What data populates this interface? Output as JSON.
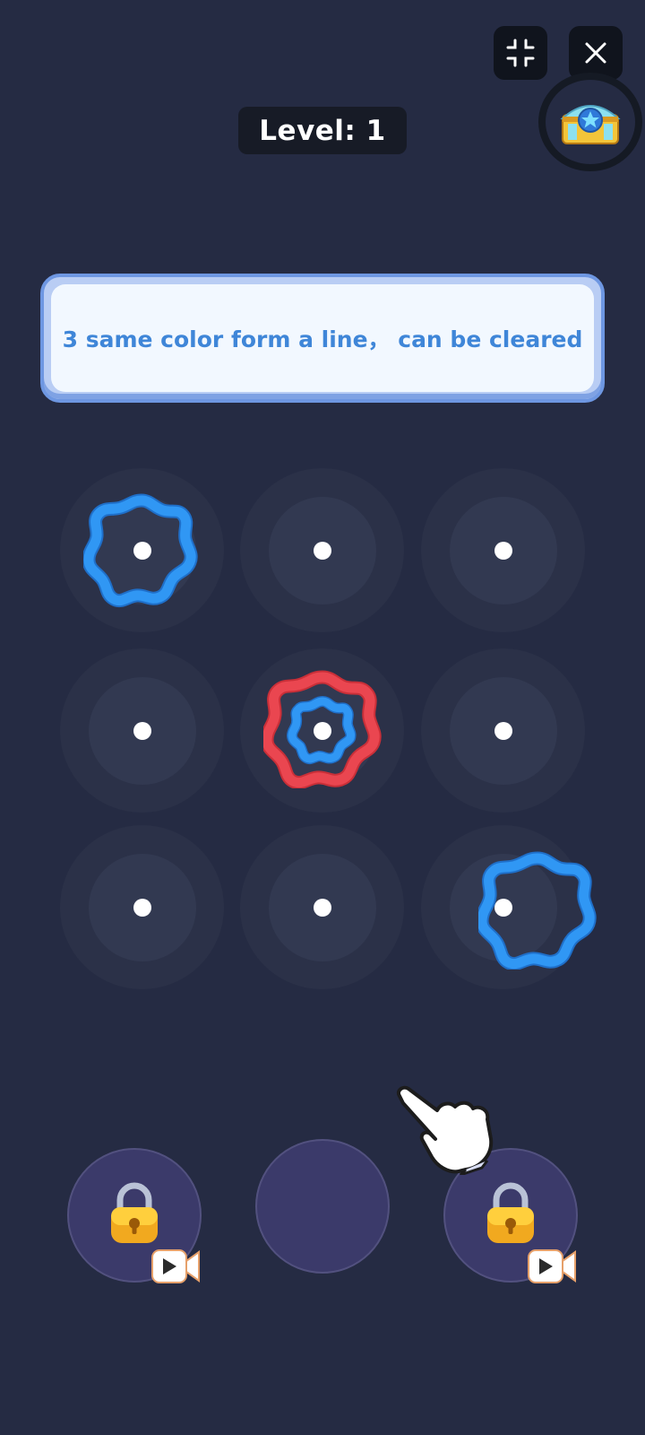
{
  "header": {
    "level_text": "Level: 1",
    "minimize_icon": "minimize-icon",
    "close_icon": "close-icon",
    "chest_icon": "treasure-chest-icon"
  },
  "hint": {
    "text": "3 same color form a line， can be cleared"
  },
  "board": {
    "rows": 3,
    "cols": 3,
    "rings": [
      {
        "row": 0,
        "col": 0,
        "layer": "outer",
        "color": "blue"
      },
      {
        "row": 1,
        "col": 1,
        "layer": "outer",
        "color": "red"
      },
      {
        "row": 1,
        "col": 1,
        "layer": "inner",
        "color": "blue"
      },
      {
        "row": 2,
        "col": 2,
        "layer": "outer",
        "color": "blue",
        "state": "dragging"
      }
    ]
  },
  "tray": {
    "slots": [
      {
        "state": "locked",
        "unlock": "video-ad"
      },
      {
        "state": "empty"
      },
      {
        "state": "locked",
        "unlock": "video-ad"
      }
    ]
  },
  "colors": {
    "background": "#252b43",
    "ring_blue": "#2f8fef",
    "ring_red": "#e8434b",
    "banner_text": "#3f86d8",
    "tray": "#3b3a6a"
  }
}
